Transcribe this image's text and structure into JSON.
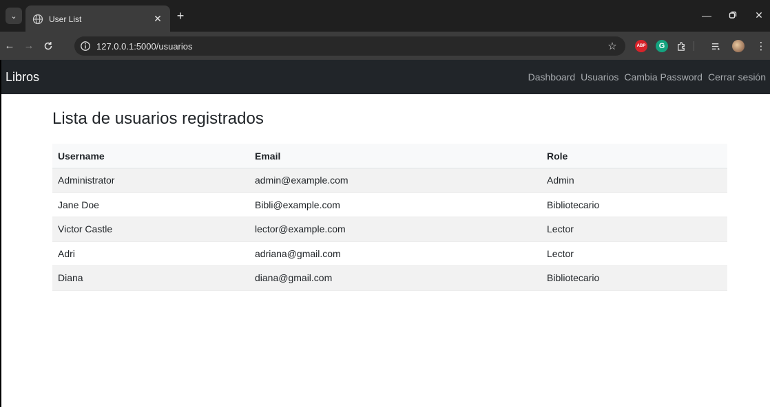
{
  "browser": {
    "tab_title": "User List",
    "url": "127.0.0.1:5000/usuarios",
    "abp_label": "ABP",
    "grammarly_label": "G"
  },
  "navbar": {
    "brand": "Libros",
    "links": [
      "Dashboard",
      "Usuarios",
      "Cambia Password",
      "Cerrar sesión"
    ]
  },
  "main": {
    "title": "Lista de usuarios registrados",
    "table": {
      "headers": [
        "Username",
        "Email",
        "Role"
      ],
      "rows": [
        [
          "Administrator",
          "admin@example.com",
          "Admin"
        ],
        [
          "Jane Doe",
          "Bibli@example.com",
          "Bibliotecario"
        ],
        [
          "Victor Castle",
          "lector@example.com",
          "Lector"
        ],
        [
          "Adri",
          "adriana@gmail.com",
          "Lector"
        ],
        [
          "Diana",
          "diana@gmail.com",
          "Bibliotecario"
        ]
      ]
    }
  },
  "colors": {
    "navbar_bg": "#212529",
    "chrome_bg": "#1f1f1f",
    "toolbar_bg": "#3c3c3c"
  }
}
